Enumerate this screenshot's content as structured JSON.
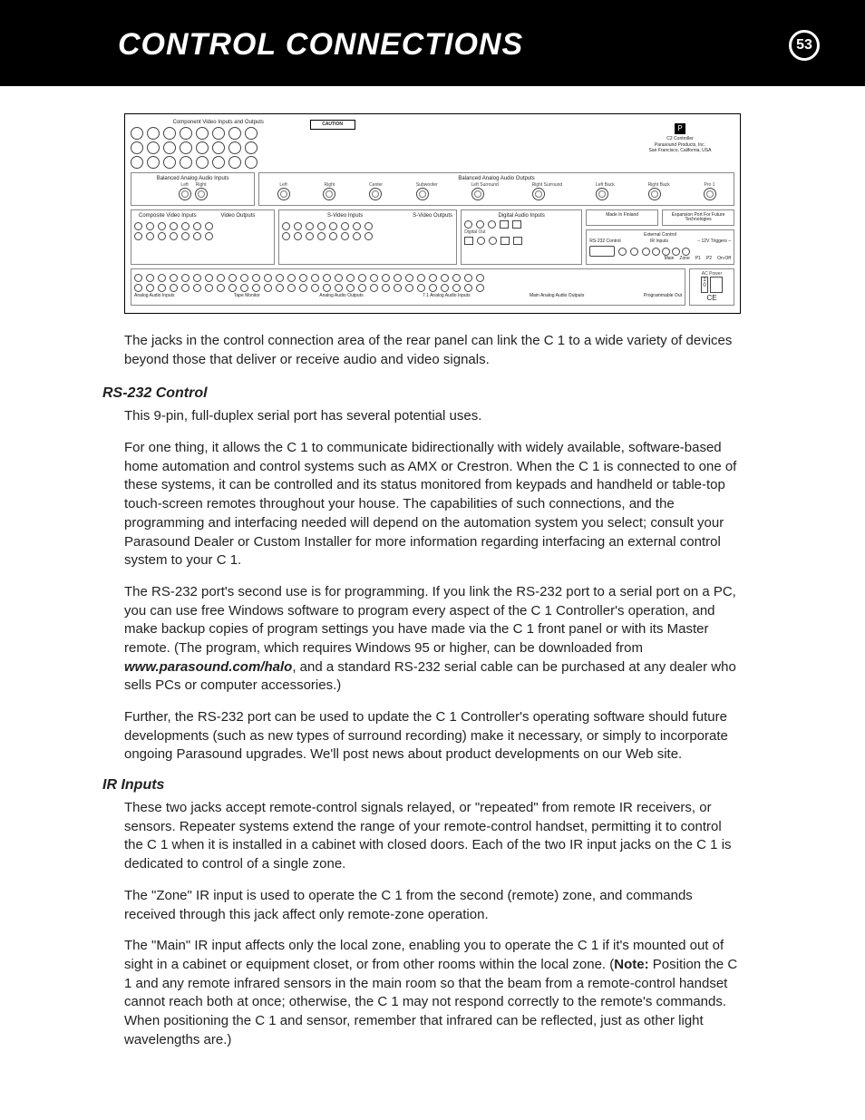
{
  "header": {
    "title": "CONTROL CONNECTIONS",
    "page_number": "53"
  },
  "diagram": {
    "component_video": "Component Video Inputs and Outputs",
    "caution": "CAUTION",
    "brand_block": {
      "product": "C2 Controller",
      "company": "Parasound Products, Inc.",
      "location": "San Francisco, California, USA"
    },
    "balanced_in": "Balanced Analog Audio Inputs",
    "balanced_out": "Balanced Analog Audio Outputs",
    "bal_in_lr": {
      "left": "Left",
      "right": "Right"
    },
    "bal_out_labels": [
      "Left",
      "Right",
      "Center",
      "Subwoofer",
      "Left Surround",
      "Right Surround",
      "Left Back",
      "Right Back",
      "Pro 1"
    ],
    "composite_in": "Composite Video Inputs",
    "video_out": "Video Outputs",
    "svideo_in": "S-Video Inputs",
    "svideo_out": "S-Video Outputs",
    "digital_in": "Digital Audio Inputs",
    "digital_out": "Digital Out",
    "made_in": "Made In Finland",
    "expansion": "Expansion Port For Future Technologies",
    "ext_ctrl": "External Control",
    "rs232": "RS-232 Control",
    "ir_inputs": "IR Inputs",
    "triggers": "– 12V Triggers –",
    "trigger_labels": [
      "Main",
      "Zone",
      "P1",
      "P2",
      "On-Off"
    ],
    "analog_in": "Analog Audio Inputs",
    "tape": "Tape Monitor",
    "analog_out": "Analog Audio Outputs",
    "seven_one": "7.1 Analog Audio Inputs",
    "main_out": "Main Analog Audio Outputs",
    "prog_out": "Programmable Out",
    "ac": "AC Power"
  },
  "intro": "The jacks in the control connection area of the rear panel can link the C 1 to a wide variety of devices beyond those that deliver or receive audio and video signals.",
  "sections": {
    "rs232": {
      "heading": "RS-232 Control",
      "p1": "This 9-pin, full-duplex serial port has several potential uses.",
      "p2": "For one thing, it allows the C 1 to communicate bidirectionally with widely available, software-based home automation and control systems such as AMX or Crestron. When the C 1 is connected to one of these systems, it can be controlled and its status monitored from keypads and handheld or table-top touch-screen remotes throughout your house. The capabilities of such connections, and the programming and interfacing needed will depend on the automation system you select; consult your Parasound Dealer or Custom Installer for more information regarding interfacing an external control system to your C 1.",
      "p3a": "The RS-232 port's second use is for programming. If you link the RS-232 port to a serial port on a PC, you can use free Windows software to program every aspect of the C 1 Controller's operation, and make backup copies of program settings you have made via the C 1 front panel or with its Master remote. (The program, which requires Windows 95 or higher, can be downloaded from ",
      "p3link": "www.parasound.com/halo",
      "p3b": ", and a standard RS-232 serial cable can be purchased at any dealer who sells PCs or computer accessories.)",
      "p4": "Further, the RS-232 port can be used to update the C 1 Controller's operating software should future developments (such as new types of surround recording) make it necessary, or simply to incorporate ongoing Parasound upgrades. We'll post news about product developments on our Web site."
    },
    "ir": {
      "heading": "IR Inputs",
      "p1": "These two jacks accept remote-control signals relayed, or \"repeated\" from remote IR receivers, or sensors. Repeater systems extend the range of your remote-control handset, permitting it to control the C 1 when it is installed in a cabinet with closed doors. Each of the two IR input jacks on the C 1 is dedicated to control of a single zone.",
      "p2": "The \"Zone\" IR input is used to operate the C 1 from the second (remote) zone, and commands received through this jack affect only remote-zone operation.",
      "p3a": "The \"Main\" IR input affects only the local zone, enabling you to operate the C 1 if it's mounted out of sight in a cabinet or equipment closet, or from other rooms within the local zone. (",
      "p3note": "Note:",
      "p3b": " Position the C 1 and any remote infrared sensors in the main room so that the beam from a remote-control handset cannot reach both at once; otherwise, the C 1 may not respond correctly to the remote's commands. When positioning the C 1 and sensor, remember that infrared can be reflected, just as other light wavelengths are.)"
    }
  }
}
